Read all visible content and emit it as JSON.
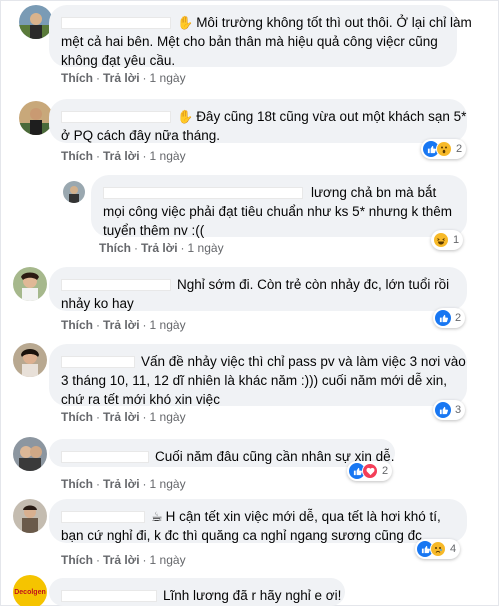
{
  "comments": [
    {
      "text": "Môi trường không tốt thì out thôi. Ở lại chỉ làm mệt cả hai bên. Mệt cho bản thân mà hiệu quả công việcr cũng không đạt yêu cầu.",
      "like": "Thích",
      "reply": "Trả lời",
      "time": "1 ngày",
      "line1": "Môi trường không tốt thì out thôi. Ở lại chỉ làm",
      "line2": "mệt cả hai bên. Mệt cho bản thân mà hiệu quả công việcr cũng",
      "line3": "không đạt yêu cầu."
    },
    {
      "line1": "Đây cũng 18t cũng vừa out một khách sạn 5*",
      "line2": "ở PQ cách đây nữa tháng.",
      "like": "Thích",
      "reply": "Trả lời",
      "time": "1 ngày",
      "reaction_count": "2"
    },
    {
      "line1": "lương chả bn mà bắt",
      "line2": "mọi công việc phải đạt tiêu chuẩn như ks 5* nhưng k thêm",
      "line3": "tuyển thêm nv :((",
      "like": "Thích",
      "reply": "Trả lời",
      "time": "1 ngày",
      "reaction_count": "1"
    },
    {
      "line1": "Nghỉ sớm đi. Còn trẻ còn nhảy đc, lớn tuổi rồi",
      "line2": "nhảy ko hay",
      "like": "Thích",
      "reply": "Trả lời",
      "time": "1 ngày",
      "reaction_count": "2"
    },
    {
      "line1": "Vấn đề nhảy việc thì chỉ pass pv và làm việc 3 nơi vào",
      "line2": "3 tháng 10, 11, 12 dĩ nhiên là khác năm :))) cuối năm mới dễ xin,",
      "line3": "chứ ra tết mới khó xin việc",
      "like": "Thích",
      "reply": "Trả lời",
      "time": "1 ngày",
      "reaction_count": "3"
    },
    {
      "line1": "Cuối năm đâu cũng cần nhân sự xin dễ.",
      "like": "Thích",
      "reply": "Trả lời",
      "time": "1 ngày",
      "reaction_count": "2"
    },
    {
      "line1": "H cận tết xin việc mới dễ, qua tết là hơi khó tí,",
      "line2": "bạn cứ nghỉ đi, k đc thì quăng ca nghỉ ngang sương cũng đc",
      "like": "Thích",
      "reply": "Trả lời",
      "time": "1 ngày",
      "reaction_count": "4"
    },
    {
      "line1": "Lĩnh lương đã r hãy nghỉ e ơi!",
      "avatar_text": "Decolgen"
    }
  ],
  "colors": {
    "bubble": "#f0f2f5",
    "meta": "#65676b",
    "like_blue": "#1877f2",
    "haha_yellow": "#f7b928",
    "love_red": "#f33e58"
  }
}
